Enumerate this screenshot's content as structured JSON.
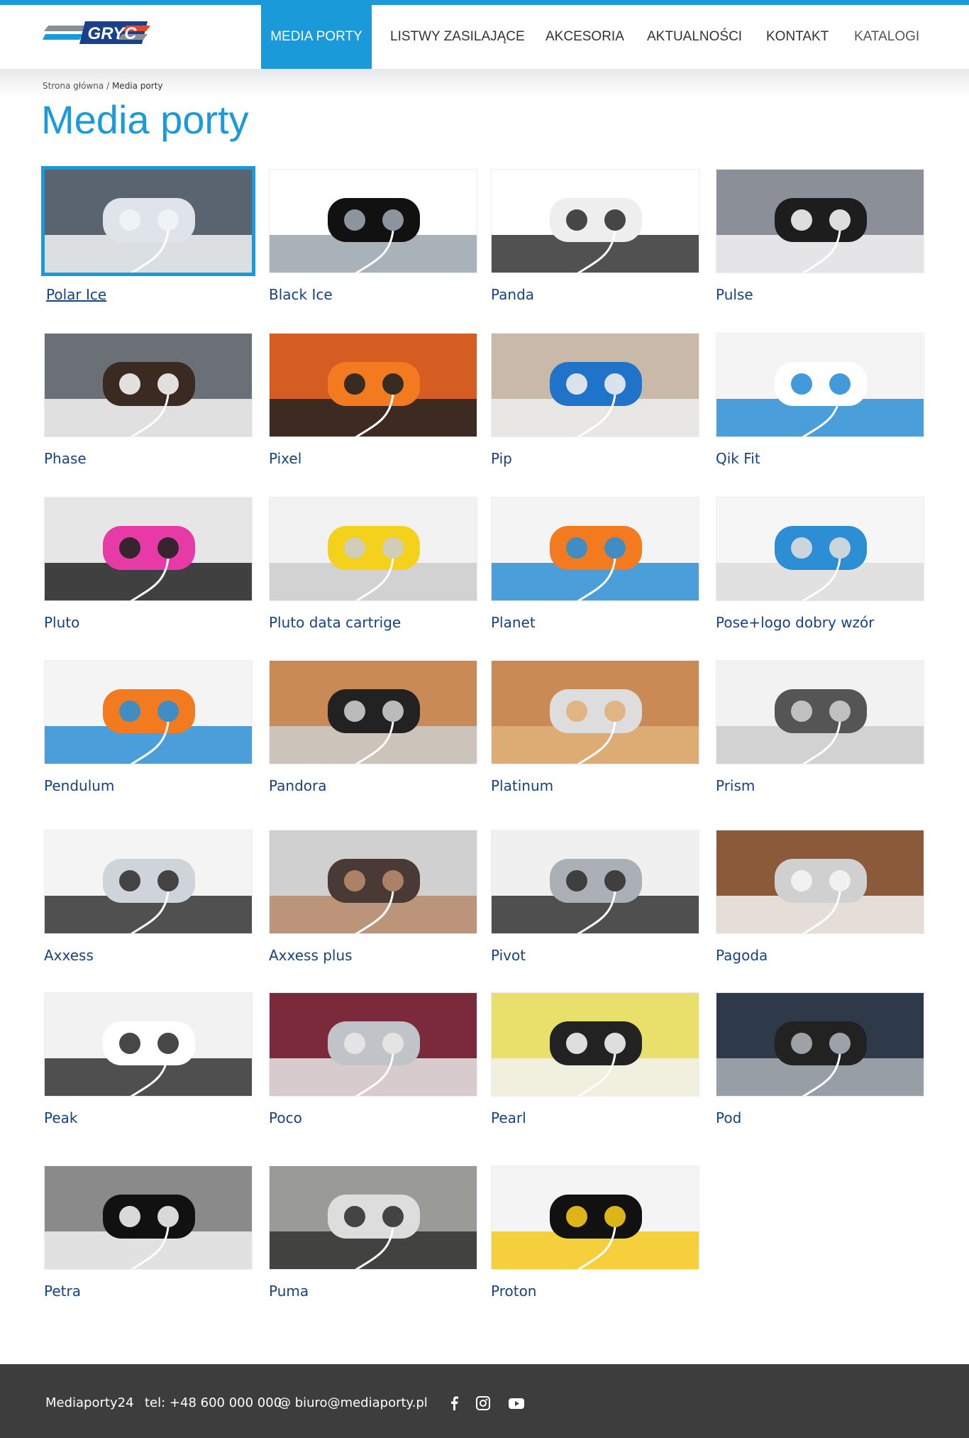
{
  "header": {
    "nav": [
      {
        "label": "MEDIA PORTY",
        "active": true
      },
      {
        "label": "LISTWY ZASILAJĄCE"
      },
      {
        "label": "AKCESORIA"
      },
      {
        "label": "AKTUALNOŚCI"
      },
      {
        "label": "KONTAKT"
      },
      {
        "label": "KATALOGI"
      }
    ],
    "logo_text": "GRYC"
  },
  "breadcrumb": {
    "home": "Strona główna",
    "separator": "/",
    "current": "Media porty"
  },
  "page_title": "Media porty",
  "products": [
    {
      "name": "Polar Ice",
      "selected": true
    },
    {
      "name": "Black Ice"
    },
    {
      "name": "Panda"
    },
    {
      "name": "Pulse"
    },
    {
      "name": "Phase"
    },
    {
      "name": "Pixel"
    },
    {
      "name": "Pip"
    },
    {
      "name": "Qik Fit"
    },
    {
      "name": "Pluto"
    },
    {
      "name": "Pluto data cartrige"
    },
    {
      "name": "Planet"
    },
    {
      "name": "Pose+logo dobry wzór"
    },
    {
      "name": "Pendulum"
    },
    {
      "name": "Pandora"
    },
    {
      "name": "Platinum"
    },
    {
      "name": "Prism"
    },
    {
      "name": "Axxess"
    },
    {
      "name": "Axxess plus"
    },
    {
      "name": "Pivot"
    },
    {
      "name": "Pagoda"
    },
    {
      "name": "Peak"
    },
    {
      "name": "Poco"
    },
    {
      "name": "Pearl"
    },
    {
      "name": "Pod"
    },
    {
      "name": "Petra"
    },
    {
      "name": "Puma"
    },
    {
      "name": "Proton"
    }
  ],
  "footer": {
    "brand": "Mediaporty24",
    "phone": "tel: +48 600 000 000",
    "email": "@ biuro@mediaporty.pl",
    "social": [
      "facebook-icon",
      "instagram-icon",
      "youtube-icon"
    ]
  },
  "colors": {
    "accent": "#1a9ad9",
    "link": "#17437c",
    "footer": "#3d3d3d"
  }
}
